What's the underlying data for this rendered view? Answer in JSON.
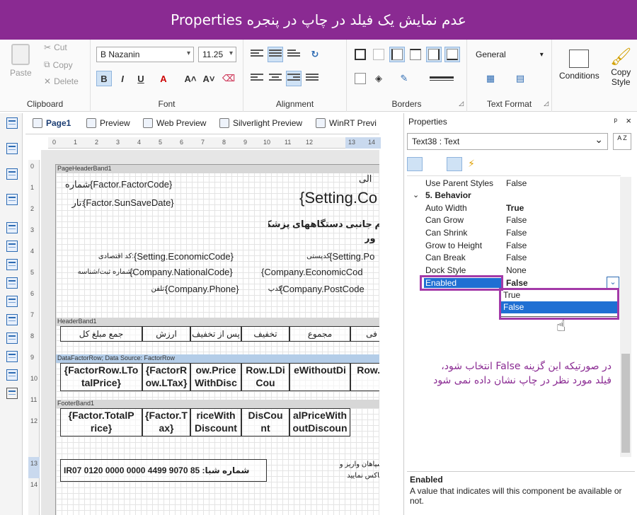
{
  "banner": {
    "title": "عدم نمایش یک فیلد در چاپ در پنجره Properties"
  },
  "ribbon": {
    "clipboard": {
      "label": "Clipboard",
      "paste": "Paste",
      "cut": "Cut",
      "copy": "Copy",
      "delete": "Delete"
    },
    "font": {
      "label": "Font",
      "family": "B Nazanin",
      "size": "11.25",
      "bold": "B",
      "italic": "I",
      "underline": "U"
    },
    "alignment": {
      "label": "Alignment"
    },
    "borders": {
      "label": "Borders"
    },
    "text_format": {
      "label": "Text Format",
      "format": "General"
    },
    "conditions": "Conditions",
    "copy_style_line1": "Copy",
    "copy_style_line2": "Style"
  },
  "tabs": [
    {
      "label": "Page1"
    },
    {
      "label": "Preview"
    },
    {
      "label": "Web Preview"
    },
    {
      "label": "Silverlight Preview"
    },
    {
      "label": "WinRT Previ"
    }
  ],
  "ruler": {
    "h_ticks": [
      "0",
      "1",
      "2",
      "3",
      "4",
      "5",
      "6",
      "7",
      "8",
      "9",
      "10",
      "11",
      "12",
      "13",
      "14"
    ],
    "v_ticks": [
      "0",
      "1",
      "2",
      "3",
      "4",
      "5",
      "6",
      "7",
      "8",
      "9",
      "10",
      "11",
      "12",
      "13",
      "14"
    ]
  },
  "report": {
    "bands": {
      "page_header": "PageHeaderBand1",
      "header": "HeaderBand1",
      "data": "DataFactorRow; Data Source: FactorRow",
      "footer": "FooterBand1"
    },
    "fields": {
      "f_number_label": ":شماره",
      "f_code": "{Factor.FactorCode}",
      "f_date_label": ":تار",
      "f_date": "{Factor.SunSaveDate}",
      "f_setting_co": "{Setting.Co",
      "f_top_right": "الی",
      "f_company_title": "م جانبی دستگاههای پزشکی",
      "f_company_sub": "ور",
      "f_economic_label": ":کد اقتصادی",
      "f_economic": "{Setting.EconomicCode}",
      "f_postal_label": ":کدپستی",
      "f_postal_setting": "{Setting.Po",
      "f_national_label": ":شماره ثبت/شناسه",
      "f_national": "{Company.NationalCode}",
      "f_company_econ": "{Company.EconomicCod",
      "f_phone_label": ":تلفن",
      "f_phone": "{Company.Phone}",
      "f_postcode_label": ":کدپ",
      "f_postcode": "{Company.PostCode",
      "f_sheba": "IR07 0120 0000 0000 4499 9070 85 :شماره شبا",
      "f_bottom_note1": "سپاهان واریز و",
      "f_bottom_note2": "فاکس نمایید"
    },
    "header_cells": [
      "جمع مبلغ کل",
      "ارزش افزوده",
      "پس از تخفیف",
      "تخفیف",
      "مجموع",
      "فی"
    ],
    "data_cells": [
      "{FactorRow.LTo talPrice}",
      "{FactorR ow.LTax}",
      "ow.Price WithDisc",
      "Row.LDi Cou",
      "eWithoutDi",
      "Row.L"
    ],
    "footer_cells": [
      "{Factor.TotalP rice}",
      "{Factor.T ax}",
      "riceWith Discount",
      "DisCou nt",
      "alPriceWith outDiscoun"
    ]
  },
  "properties": {
    "title": "Properties",
    "pin": "ᵖ",
    "close": "×",
    "object": "Text38 : Text",
    "sort_label": "A Z",
    "rows": [
      {
        "name": "Use Parent Styles",
        "value": "False"
      },
      {
        "name": "5. Behavior",
        "value": ""
      },
      {
        "name": "Auto Width",
        "value": "True"
      },
      {
        "name": "Can Grow",
        "value": "False"
      },
      {
        "name": "Can Shrink",
        "value": "False"
      },
      {
        "name": "Grow to Height",
        "value": "False"
      },
      {
        "name": "Can Break",
        "value": "False"
      },
      {
        "name": "Dock Style",
        "value": "None"
      },
      {
        "name": "Enabled",
        "value": "False"
      }
    ],
    "dropdown": [
      "True",
      "False"
    ],
    "help_title": "Enabled",
    "help_text": "A value that indicates will this component be available or not."
  },
  "annotation": {
    "line1": "در صورتیکه این گزینه False انتخاب شود،",
    "line2": "فیلد مورد نظر در چاپ نشان داده نمی شود"
  },
  "colors": {
    "banner": "#8a2a92",
    "highlight_frame": "#a33aa8",
    "selection": "#1f6fd3"
  }
}
